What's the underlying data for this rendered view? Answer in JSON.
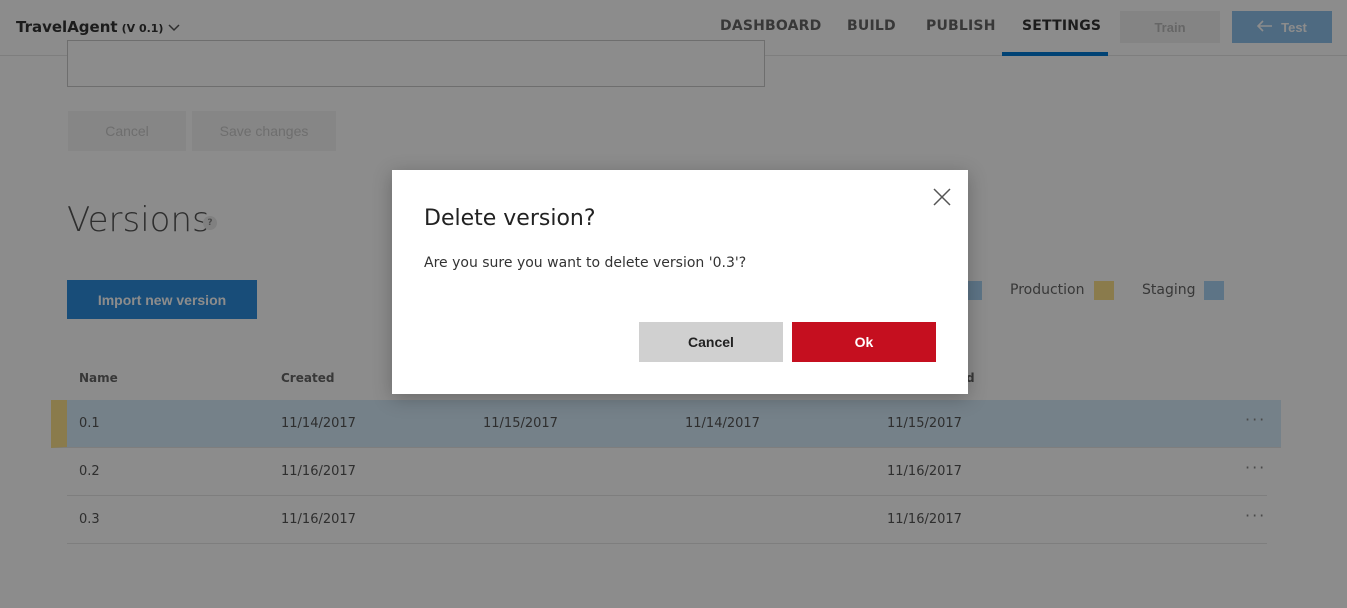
{
  "header": {
    "app_name": "TravelAgent",
    "version": "(V 0.1)",
    "nav": [
      "DASHBOARD",
      "BUILD",
      "PUBLISH",
      "SETTINGS"
    ],
    "active_nav": "SETTINGS",
    "train_label": "Train",
    "test_label": "Test"
  },
  "form": {
    "cancel_label": "Cancel",
    "save_label": "Save changes"
  },
  "versions": {
    "title": "Versions",
    "help": "?",
    "import_label": "Import new version",
    "legend": [
      {
        "label": "Production",
        "color": "#fce08a"
      },
      {
        "label": "Staging",
        "color": "#a9d3f5"
      }
    ],
    "columns": [
      "Name",
      "Created",
      "",
      "",
      "d"
    ],
    "rows": [
      {
        "name": "0.1",
        "created": "11/14/2017",
        "c3": "11/15/2017",
        "c4": "11/14/2017",
        "c5": "11/15/2017",
        "more": "···"
      },
      {
        "name": "0.2",
        "created": "11/16/2017",
        "c3": "",
        "c4": "",
        "c5": "11/16/2017",
        "more": "···"
      },
      {
        "name": "0.3",
        "created": "11/16/2017",
        "c3": "",
        "c4": "",
        "c5": "11/16/2017",
        "more": "···"
      }
    ]
  },
  "dialog": {
    "title": "Delete version?",
    "message": "Are you sure you want to delete version '0.3'?",
    "cancel_label": "Cancel",
    "ok_label": "Ok"
  },
  "colors": {
    "accent": "#0078d4",
    "danger": "#c50f1f",
    "import_button": "#2c8ddc"
  }
}
